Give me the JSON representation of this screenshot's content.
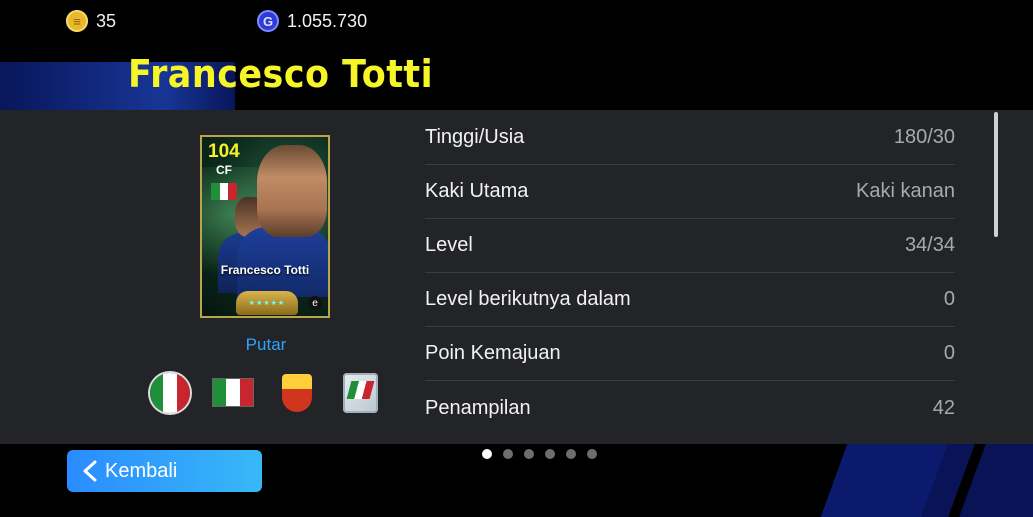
{
  "currency": {
    "coins": {
      "icon": "coin-icon",
      "value": "35"
    },
    "gp": {
      "icon": "gp-icon",
      "value": "1.055.730"
    }
  },
  "player": {
    "name": "Francesco Totti",
    "card": {
      "rating": "104",
      "position": "CF",
      "name": "Francesco Totti",
      "nationality_flag_colors": [
        "#1f8f3a",
        "#ffffff",
        "#c8262f"
      ]
    },
    "rotate_label": "Putar"
  },
  "stats": [
    {
      "label": "Tinggi/Usia",
      "value": "180/30"
    },
    {
      "label": "Kaki Utama",
      "value": "Kaki kanan"
    },
    {
      "label": "Level",
      "value": "34/34"
    },
    {
      "label": "Level berikutnya dalam",
      "value": "0"
    },
    {
      "label": "Poin Kemajuan",
      "value": "0"
    },
    {
      "label": "Penampilan",
      "value": "42"
    }
  ],
  "pagination": {
    "total": 6,
    "active": 0
  },
  "back_button": {
    "label": "Kembali"
  },
  "colors": {
    "name": "#f5f528",
    "accent_link": "#2aa4ff",
    "button": "#2a8cff",
    "panel": "#232427"
  }
}
